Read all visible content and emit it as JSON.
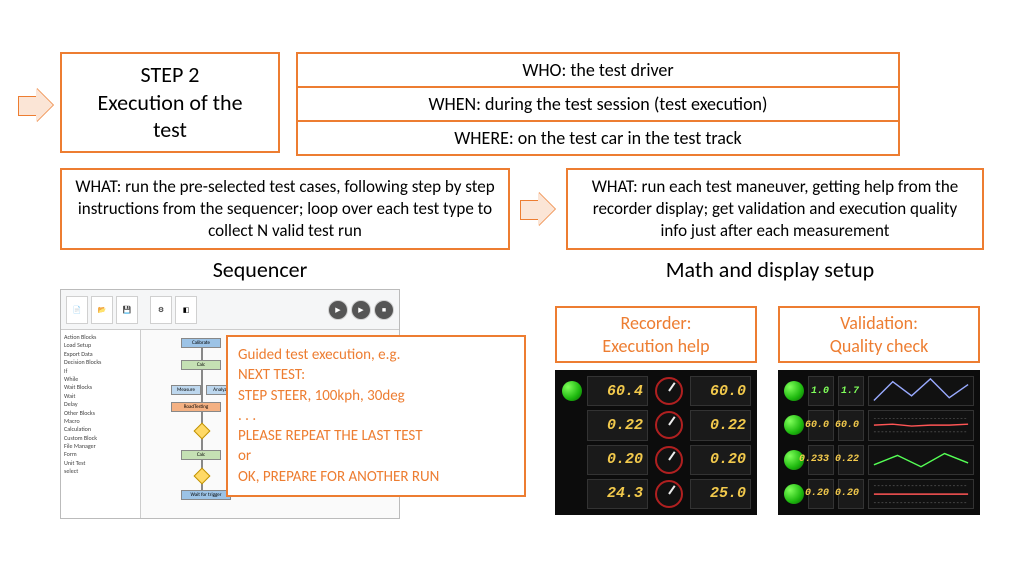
{
  "step": {
    "title_line1": "STEP 2",
    "title_line2": "Execution of the",
    "title_line3": "test"
  },
  "www": {
    "who": "WHO: the test driver",
    "when": "WHEN: during the test session (test execution)",
    "where": "WHERE: on the test car in the test track"
  },
  "what_left": "WHAT: run the pre-selected test cases, following step by step instructions from the sequencer; loop over each test type to collect N valid test run",
  "what_right": "WHAT: run each test maneuver, getting help from the recorder display; get validation and execution quality info just after each measurement",
  "headings": {
    "sequencer": "Sequencer",
    "math": "Math and display setup"
  },
  "guided": {
    "l1": "Guided test execution, e.g.",
    "l2": "NEXT TEST:",
    "l3": "STEP STEER, 100kph, 30deg",
    "l4": ". . .",
    "l5": "PLEASE REPEAT THE LAST TEST",
    "l6": "or",
    "l7": "OK, PREPARE FOR ANOTHER RUN"
  },
  "recorder_label": {
    "l1": "Recorder:",
    "l2": "Execution help"
  },
  "validation_label": {
    "l1": "Validation:",
    "l2": "Quality  check"
  },
  "recorder": {
    "r1_left": "60.4",
    "r1_right": "60.0",
    "r2_left": "0.22",
    "r2_right": "0.22",
    "r3_left": "0.20",
    "r3_right": "0.20",
    "r4_left": "24.3",
    "r4_right": "25.0"
  },
  "validation": {
    "r1_a": "1.0",
    "r1_b": "1.7",
    "r2_a": "60.0",
    "r2_b": "60.0",
    "r3_a": "0.233",
    "r3_b": "0.22",
    "r4_a": "0.20",
    "r4_b": "0.20"
  },
  "sequencer_tree": [
    "Action Blocks",
    "  Load Setup",
    "  Export Data",
    "Decision Blocks",
    "  If",
    "  While",
    "Wait Blocks",
    "  Wait",
    "  Delay",
    "Other Blocks",
    "  Macro",
    "  Calculation",
    "  Custom Block",
    "  File Manager",
    "  Form",
    "Unit Test",
    "  select"
  ],
  "sequencer_nodes": {
    "n1": "Measure",
    "n2": "Analyze",
    "n3": "RoadTesting",
    "n4": "Calibrate",
    "n5": "Calc",
    "n6": "Wait for trigger"
  }
}
